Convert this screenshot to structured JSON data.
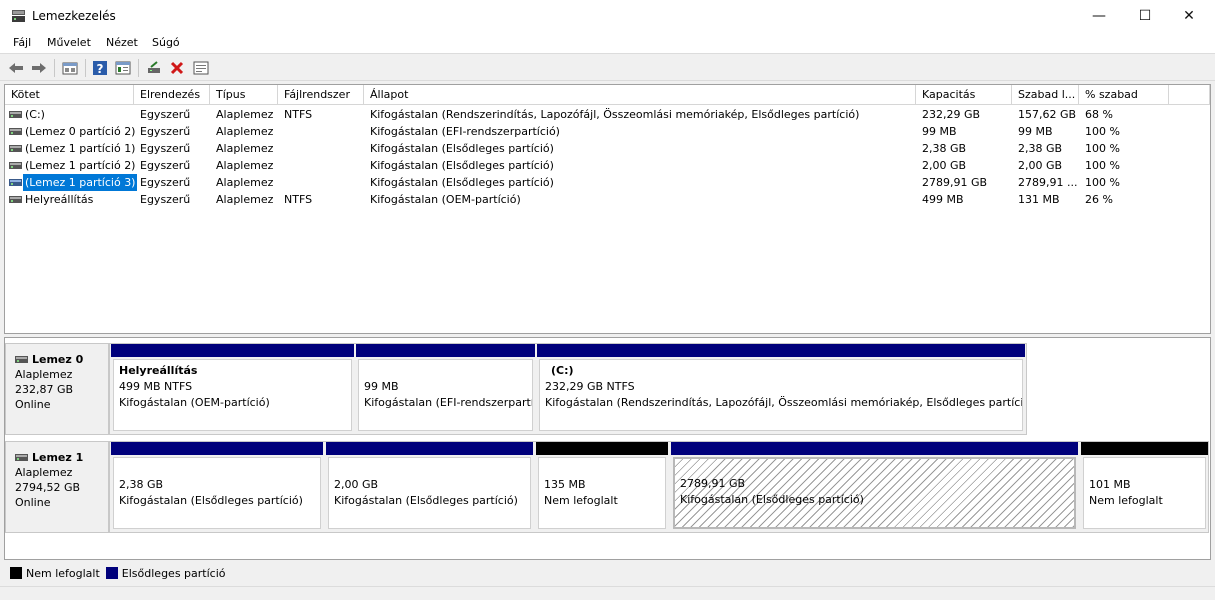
{
  "window": {
    "title": "Lemezkezelés",
    "controls": [
      "—",
      "☐",
      "✕"
    ]
  },
  "menu": [
    "Fájl",
    "Művelet",
    "Nézet",
    "Súgó"
  ],
  "toolbar": [
    "back-icon",
    "forward-icon",
    "disk-list-icon",
    "help-icon",
    "properties-icon",
    "connect-disk-icon",
    "delete-icon",
    "console-icon"
  ],
  "volumes": {
    "columns": [
      "Kötet",
      "Elrendezés",
      "Típus",
      "Fájlrendszer",
      "Állapot",
      "Kapacitás",
      "Szabad l...",
      "% szabad"
    ],
    "rows": [
      {
        "kotet": "(C:)",
        "elrendezes": "Egyszerű",
        "tipus": "Alaplemez",
        "fajlrendszer": "NTFS",
        "allapot": "Kifogástalan (Rendszerindítás, Lapozófájl, Összeomlási memóriakép, Elsődleges partíció)",
        "kapacitas": "232,29 GB",
        "szabad": "157,62 GB",
        "szazalek": "68 %"
      },
      {
        "kotet": "(Lemez 0 partíció 2)",
        "elrendezes": "Egyszerű",
        "tipus": "Alaplemez",
        "fajlrendszer": "",
        "allapot": "Kifogástalan (EFI-rendszerpartíció)",
        "kapacitas": "99 MB",
        "szabad": "99 MB",
        "szazalek": "100 %"
      },
      {
        "kotet": "(Lemez 1 partíció 1)",
        "elrendezes": "Egyszerű",
        "tipus": "Alaplemez",
        "fajlrendszer": "",
        "allapot": "Kifogástalan (Elsődleges partíció)",
        "kapacitas": "2,38 GB",
        "szabad": "2,38 GB",
        "szazalek": "100 %"
      },
      {
        "kotet": "(Lemez 1 partíció 2)",
        "elrendezes": "Egyszerű",
        "tipus": "Alaplemez",
        "fajlrendszer": "",
        "allapot": "Kifogástalan (Elsődleges partíció)",
        "kapacitas": "2,00 GB",
        "szabad": "2,00 GB",
        "szazalek": "100 %"
      },
      {
        "kotet": "(Lemez 1 partíció 3)",
        "elrendezes": "Egyszerű",
        "tipus": "Alaplemez",
        "fajlrendszer": "",
        "allapot": "Kifogástalan (Elsődleges partíció)",
        "kapacitas": "2789,91 GB",
        "szabad": "2789,91 ...",
        "szazalek": "100 %"
      },
      {
        "kotet": "Helyreállítás",
        "elrendezes": "Egyszerű",
        "tipus": "Alaplemez",
        "fajlrendszer": "NTFS",
        "allapot": "Kifogástalan (OEM-partíció)",
        "kapacitas": "499 MB",
        "szabad": "131 MB",
        "szazalek": "26 %"
      }
    ]
  },
  "disks": [
    {
      "name": "Lemez 0",
      "type": "Alaplemez",
      "size": "232,87 GB",
      "status": "Online",
      "partitions": [
        {
          "title": "Helyreállítás",
          "line1": "499 MB NTFS",
          "line2": "Kifogástalan (OEM-partíció)",
          "kind": "primary"
        },
        {
          "title": "",
          "line1": "99 MB",
          "line2": "Kifogástalan (EFI-rendszerpartíc",
          "kind": "primary"
        },
        {
          "title": "(C:)",
          "line1": "232,29 GB NTFS",
          "line2": "Kifogástalan (Rendszerindítás, Lapozófájl, Összeomlási memóriakép, Elsődleges partíció)",
          "kind": "primary"
        }
      ]
    },
    {
      "name": "Lemez 1",
      "type": "Alaplemez",
      "size": "2794,52 GB",
      "status": "Online",
      "partitions": [
        {
          "title": "",
          "line1": "2,38 GB",
          "line2": "Kifogástalan (Elsődleges partíció)",
          "kind": "primary"
        },
        {
          "title": "",
          "line1": "2,00 GB",
          "line2": "Kifogástalan (Elsődleges partíció)",
          "kind": "primary"
        },
        {
          "title": "",
          "line1": "135 MB",
          "line2": "Nem lefoglalt",
          "kind": "unallocated"
        },
        {
          "title": "",
          "line1": "2789,91 GB",
          "line2": "Kifogástalan (Elsődleges partíció)",
          "kind": "primary-selected"
        },
        {
          "title": "",
          "line1": "101 MB",
          "line2": "Nem lefoglalt",
          "kind": "unallocated"
        }
      ]
    }
  ],
  "legend": [
    {
      "label": "Nem lefoglalt",
      "color": "#000000"
    },
    {
      "label": "Elsődleges partíció",
      "color": "#00007b"
    }
  ],
  "colors": {
    "primary": "#00007b",
    "unallocated": "#000000",
    "selection": "#0078d7"
  }
}
